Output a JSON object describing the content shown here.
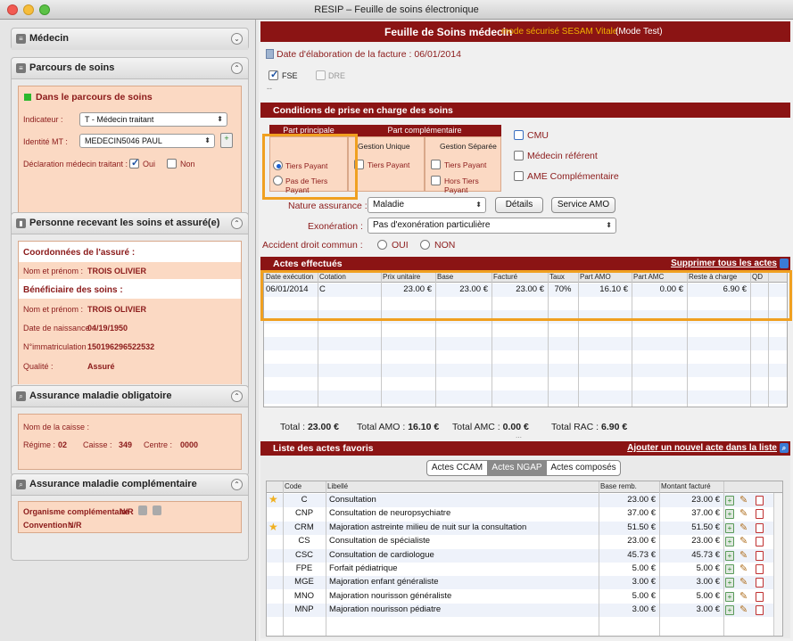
{
  "window": {
    "title": "RESIP – Feuille de soins électronique"
  },
  "left": {
    "medecin": {
      "title": "Médecin"
    },
    "parcours": {
      "title": "Parcours de soins",
      "status": "Dans le parcours de soins",
      "indicateur_label": "Indicateur :",
      "indicateur_value": "T - Médecin traitant",
      "identite_label": "Identité MT :",
      "identite_value": "MEDECIN5046 PAUL",
      "declaration_label": "Déclaration médecin traitant :",
      "oui": "Oui",
      "non": "Non"
    },
    "personne": {
      "title": "Personne recevant les soins et assuré(e)",
      "coord_title": "Coordonnées de l'assuré :",
      "nom_label": "Nom et prénom :",
      "nom_value": "TROIS OLIVIER",
      "benef_title": "Bénéficiaire des soins :",
      "benef_nom_label": "Nom et prénom :",
      "benef_nom_value": "TROIS OLIVIER",
      "naissance_label": "Date de naissance :",
      "naissance_value": "04/19/1950",
      "immat_label": "N°immatriculation :",
      "immat_value": "150196296522532",
      "qualite_label": "Qualité :",
      "qualite_value": "Assuré"
    },
    "amo": {
      "title": "Assurance maladie obligatoire",
      "caisse_label": "Nom de la caisse :",
      "regime_label": "Régime :",
      "regime_value": "02",
      "caisse2_label": "Caisse :",
      "caisse2_value": "349",
      "centre_label": "Centre :",
      "centre_value": "0000"
    },
    "amc": {
      "title": "Assurance maladie complémentaire",
      "org_label": "Organisme complémentaire :",
      "org_value": "N/R",
      "conv_label": "Convention :",
      "conv_value": "N/R"
    }
  },
  "main": {
    "header_title": "Feuille de Soins médecin",
    "header_mode": "mode sécurisé SESAM Vitale",
    "header_test": "(Mode Test)",
    "date_label": "Date d'élaboration de la facture : 06/01/2014",
    "fse": "FSE",
    "dre": "DRE",
    "dashes": "--",
    "conditions_title": "Conditions de prise en charge des soins",
    "part_principale": "Part principale",
    "part_complementaire": "Part complémentaire",
    "gestion_unique": "Gestion Unique",
    "gestion_separee": "Gestion Séparée",
    "tiers_payant": "Tiers Payant",
    "pas_tiers_payant": "Pas de Tiers Payant",
    "gu_tiers": "Tiers Payant",
    "gs_tiers": "Tiers Payant",
    "gs_hors": "Hors Tiers Payant",
    "cmu": "CMU",
    "medecin_referent": "Médecin référent",
    "ame": "AME Complémentaire",
    "nature_label": "Nature assurance :",
    "nature_value": "Maladie",
    "details_btn": "Détails",
    "service_amo_btn": "Service AMO",
    "exo_label": "Exonération :",
    "exo_value": "Pas d'exonération particulière",
    "accident_label": "Accident droit commun :",
    "accident_oui": "OUI",
    "accident_non": "NON",
    "actes_title": "Actes effectués",
    "supprimer": "Supprimer tous les actes",
    "actes_headers": [
      "Date exécution",
      "Cotation",
      "Prix unitaire",
      "Base",
      "Facturé",
      "Taux",
      "Part AMO",
      "Part AMC",
      "Reste à charge",
      "QD"
    ],
    "actes_rows": [
      [
        "06/01/2014",
        "C",
        "23.00 €",
        "23.00 €",
        "23.00 €",
        "70%",
        "16.10 €",
        "0.00 €",
        "6.90 €",
        ""
      ]
    ],
    "totals": {
      "total_label": "Total :",
      "total_value": "23.00 €",
      "amo_label": "Total AMO :",
      "amo_value": "16.10 €",
      "amc_label": "Total AMC :",
      "amc_value": "0.00 €",
      "rac_label": "Total RAC :",
      "rac_value": "6.90 €"
    },
    "favoris_title": "Liste des actes favoris",
    "ajouter": "Ajouter un nouvel acte dans la liste",
    "tabs": [
      "Actes CCAM",
      "Actes NGAP",
      "Actes composés"
    ],
    "fav_headers": [
      "Code",
      "Libellé",
      "Base remb.",
      "Montant facturé"
    ],
    "fav_rows": [
      {
        "star": true,
        "code": "C",
        "libelle": "Consultation",
        "base": "23.00 €",
        "montant": "23.00 €"
      },
      {
        "star": false,
        "code": "CNP",
        "libelle": "Consultation de neuropsychiatre",
        "base": "37.00 €",
        "montant": "37.00 €"
      },
      {
        "star": true,
        "code": "CRM",
        "libelle": "Majoration astreinte milieu de nuit sur la consultation",
        "base": "51.50 €",
        "montant": "51.50 €"
      },
      {
        "star": false,
        "code": "CS",
        "libelle": "Consultation de spécialiste",
        "base": "23.00 €",
        "montant": "23.00 €"
      },
      {
        "star": false,
        "code": "CSC",
        "libelle": "Consultation de cardiologue",
        "base": "45.73 €",
        "montant": "45.73 €"
      },
      {
        "star": false,
        "code": "FPE",
        "libelle": "Forfait pédiatrique",
        "base": "5.00 €",
        "montant": "5.00 €"
      },
      {
        "star": false,
        "code": "MGE",
        "libelle": "Majoration enfant généraliste",
        "base": "3.00 €",
        "montant": "3.00 €"
      },
      {
        "star": false,
        "code": "MNO",
        "libelle": "Majoration nourisson généraliste",
        "base": "5.00 €",
        "montant": "5.00 €"
      },
      {
        "star": false,
        "code": "MNP",
        "libelle": "Majoration nourisson pédiatre",
        "base": "3.00 €",
        "montant": "3.00 €"
      }
    ]
  },
  "colors": {
    "dark_red": "#8b1414",
    "salmon": "#fbd9c3",
    "highlight": "#f0a020",
    "label_red": "#8b1a1a"
  }
}
